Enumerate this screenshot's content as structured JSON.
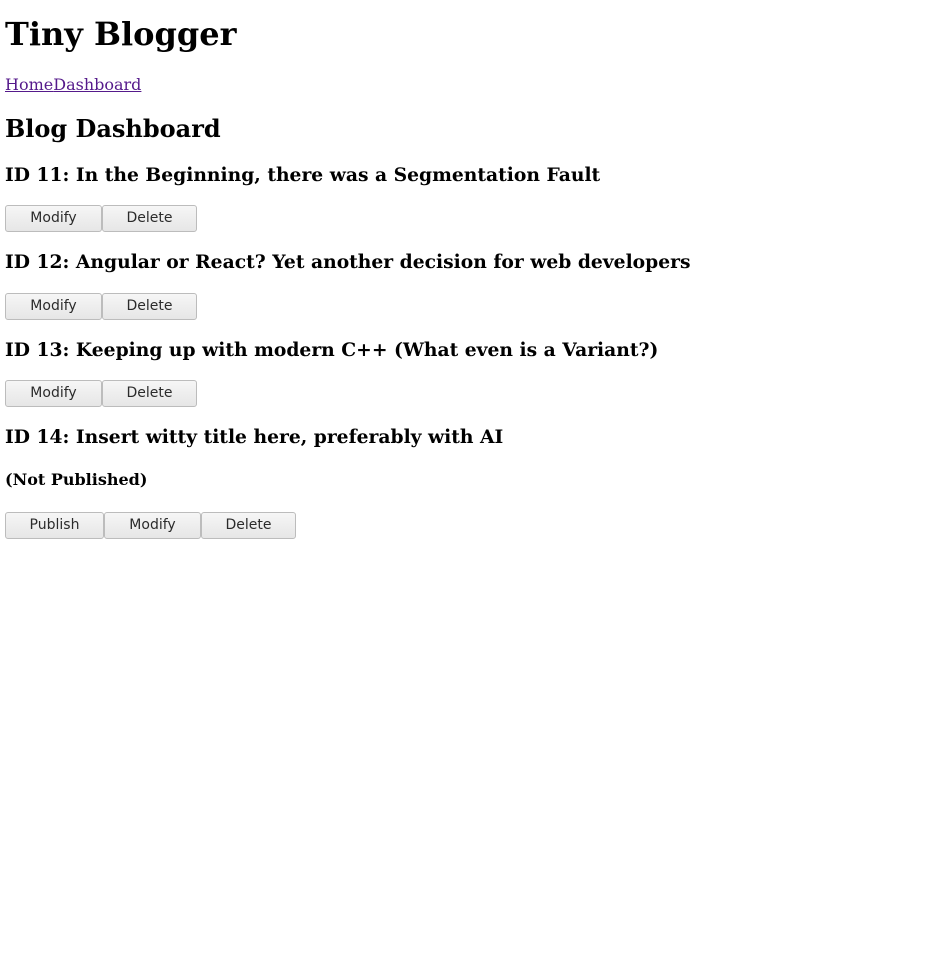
{
  "site": {
    "title": "Tiny Blogger"
  },
  "nav": {
    "home": "Home",
    "dashboard": "Dashboard"
  },
  "dashboard": {
    "title": "Blog Dashboard"
  },
  "posts": [
    {
      "heading": "ID 11: In the Beginning, there was a Segmentation Fault",
      "modify_label": "Modify",
      "delete_label": "Delete"
    },
    {
      "heading": "ID 12: Angular or React? Yet another decision for web developers",
      "modify_label": "Modify",
      "delete_label": "Delete"
    },
    {
      "heading": "ID 13: Keeping up with modern C++ (What even is a Variant?)",
      "modify_label": "Modify",
      "delete_label": "Delete"
    },
    {
      "heading": "ID 14: Insert witty title here, preferably with AI",
      "status": "(Not Published)",
      "publish_label": "Publish",
      "modify_label": "Modify",
      "delete_label": "Delete"
    }
  ]
}
